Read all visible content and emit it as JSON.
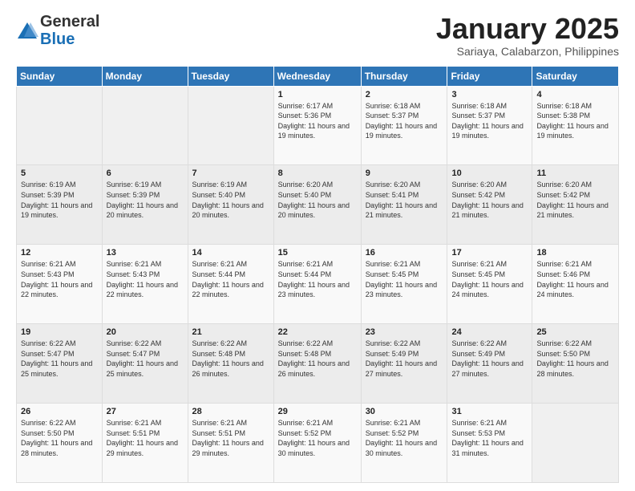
{
  "logo": {
    "general": "General",
    "blue": "Blue"
  },
  "header": {
    "month": "January 2025",
    "location": "Sariaya, Calabarzon, Philippines"
  },
  "weekdays": [
    "Sunday",
    "Monday",
    "Tuesday",
    "Wednesday",
    "Thursday",
    "Friday",
    "Saturday"
  ],
  "weeks": [
    [
      {
        "day": "",
        "sunrise": "",
        "sunset": "",
        "daylight": ""
      },
      {
        "day": "",
        "sunrise": "",
        "sunset": "",
        "daylight": ""
      },
      {
        "day": "",
        "sunrise": "",
        "sunset": "",
        "daylight": ""
      },
      {
        "day": "1",
        "sunrise": "Sunrise: 6:17 AM",
        "sunset": "Sunset: 5:36 PM",
        "daylight": "Daylight: 11 hours and 19 minutes."
      },
      {
        "day": "2",
        "sunrise": "Sunrise: 6:18 AM",
        "sunset": "Sunset: 5:37 PM",
        "daylight": "Daylight: 11 hours and 19 minutes."
      },
      {
        "day": "3",
        "sunrise": "Sunrise: 6:18 AM",
        "sunset": "Sunset: 5:37 PM",
        "daylight": "Daylight: 11 hours and 19 minutes."
      },
      {
        "day": "4",
        "sunrise": "Sunrise: 6:18 AM",
        "sunset": "Sunset: 5:38 PM",
        "daylight": "Daylight: 11 hours and 19 minutes."
      }
    ],
    [
      {
        "day": "5",
        "sunrise": "Sunrise: 6:19 AM",
        "sunset": "Sunset: 5:39 PM",
        "daylight": "Daylight: 11 hours and 19 minutes."
      },
      {
        "day": "6",
        "sunrise": "Sunrise: 6:19 AM",
        "sunset": "Sunset: 5:39 PM",
        "daylight": "Daylight: 11 hours and 20 minutes."
      },
      {
        "day": "7",
        "sunrise": "Sunrise: 6:19 AM",
        "sunset": "Sunset: 5:40 PM",
        "daylight": "Daylight: 11 hours and 20 minutes."
      },
      {
        "day": "8",
        "sunrise": "Sunrise: 6:20 AM",
        "sunset": "Sunset: 5:40 PM",
        "daylight": "Daylight: 11 hours and 20 minutes."
      },
      {
        "day": "9",
        "sunrise": "Sunrise: 6:20 AM",
        "sunset": "Sunset: 5:41 PM",
        "daylight": "Daylight: 11 hours and 21 minutes."
      },
      {
        "day": "10",
        "sunrise": "Sunrise: 6:20 AM",
        "sunset": "Sunset: 5:42 PM",
        "daylight": "Daylight: 11 hours and 21 minutes."
      },
      {
        "day": "11",
        "sunrise": "Sunrise: 6:20 AM",
        "sunset": "Sunset: 5:42 PM",
        "daylight": "Daylight: 11 hours and 21 minutes."
      }
    ],
    [
      {
        "day": "12",
        "sunrise": "Sunrise: 6:21 AM",
        "sunset": "Sunset: 5:43 PM",
        "daylight": "Daylight: 11 hours and 22 minutes."
      },
      {
        "day": "13",
        "sunrise": "Sunrise: 6:21 AM",
        "sunset": "Sunset: 5:43 PM",
        "daylight": "Daylight: 11 hours and 22 minutes."
      },
      {
        "day": "14",
        "sunrise": "Sunrise: 6:21 AM",
        "sunset": "Sunset: 5:44 PM",
        "daylight": "Daylight: 11 hours and 22 minutes."
      },
      {
        "day": "15",
        "sunrise": "Sunrise: 6:21 AM",
        "sunset": "Sunset: 5:44 PM",
        "daylight": "Daylight: 11 hours and 23 minutes."
      },
      {
        "day": "16",
        "sunrise": "Sunrise: 6:21 AM",
        "sunset": "Sunset: 5:45 PM",
        "daylight": "Daylight: 11 hours and 23 minutes."
      },
      {
        "day": "17",
        "sunrise": "Sunrise: 6:21 AM",
        "sunset": "Sunset: 5:45 PM",
        "daylight": "Daylight: 11 hours and 24 minutes."
      },
      {
        "day": "18",
        "sunrise": "Sunrise: 6:21 AM",
        "sunset": "Sunset: 5:46 PM",
        "daylight": "Daylight: 11 hours and 24 minutes."
      }
    ],
    [
      {
        "day": "19",
        "sunrise": "Sunrise: 6:22 AM",
        "sunset": "Sunset: 5:47 PM",
        "daylight": "Daylight: 11 hours and 25 minutes."
      },
      {
        "day": "20",
        "sunrise": "Sunrise: 6:22 AM",
        "sunset": "Sunset: 5:47 PM",
        "daylight": "Daylight: 11 hours and 25 minutes."
      },
      {
        "day": "21",
        "sunrise": "Sunrise: 6:22 AM",
        "sunset": "Sunset: 5:48 PM",
        "daylight": "Daylight: 11 hours and 26 minutes."
      },
      {
        "day": "22",
        "sunrise": "Sunrise: 6:22 AM",
        "sunset": "Sunset: 5:48 PM",
        "daylight": "Daylight: 11 hours and 26 minutes."
      },
      {
        "day": "23",
        "sunrise": "Sunrise: 6:22 AM",
        "sunset": "Sunset: 5:49 PM",
        "daylight": "Daylight: 11 hours and 27 minutes."
      },
      {
        "day": "24",
        "sunrise": "Sunrise: 6:22 AM",
        "sunset": "Sunset: 5:49 PM",
        "daylight": "Daylight: 11 hours and 27 minutes."
      },
      {
        "day": "25",
        "sunrise": "Sunrise: 6:22 AM",
        "sunset": "Sunset: 5:50 PM",
        "daylight": "Daylight: 11 hours and 28 minutes."
      }
    ],
    [
      {
        "day": "26",
        "sunrise": "Sunrise: 6:22 AM",
        "sunset": "Sunset: 5:50 PM",
        "daylight": "Daylight: 11 hours and 28 minutes."
      },
      {
        "day": "27",
        "sunrise": "Sunrise: 6:21 AM",
        "sunset": "Sunset: 5:51 PM",
        "daylight": "Daylight: 11 hours and 29 minutes."
      },
      {
        "day": "28",
        "sunrise": "Sunrise: 6:21 AM",
        "sunset": "Sunset: 5:51 PM",
        "daylight": "Daylight: 11 hours and 29 minutes."
      },
      {
        "day": "29",
        "sunrise": "Sunrise: 6:21 AM",
        "sunset": "Sunset: 5:52 PM",
        "daylight": "Daylight: 11 hours and 30 minutes."
      },
      {
        "day": "30",
        "sunrise": "Sunrise: 6:21 AM",
        "sunset": "Sunset: 5:52 PM",
        "daylight": "Daylight: 11 hours and 30 minutes."
      },
      {
        "day": "31",
        "sunrise": "Sunrise: 6:21 AM",
        "sunset": "Sunset: 5:53 PM",
        "daylight": "Daylight: 11 hours and 31 minutes."
      },
      {
        "day": "",
        "sunrise": "",
        "sunset": "",
        "daylight": ""
      }
    ]
  ]
}
